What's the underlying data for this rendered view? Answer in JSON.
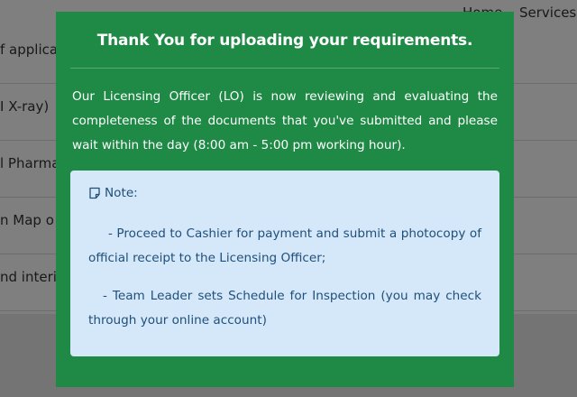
{
  "background": {
    "nav": {
      "home": "Home",
      "services": "Services"
    },
    "rows": [
      "f applica",
      "I X-ray)",
      "l Pharma",
      "n Map o",
      "nd interio"
    ]
  },
  "modal": {
    "title": "Thank You for uploading your requirements.",
    "message": "Our Licensing Officer (LO) is now reviewing and evaluating the completeness of the documents that you've submitted and please wait within the day (8:00 am - 5:00 pm working hour).",
    "note": {
      "icon": "note-icon",
      "heading": "Note:",
      "items": [
        "- Proceed to Cashier for payment and submit a photocopy of official receipt to the Licensing Officer;",
        "- Team Leader sets Schedule for Inspection (you may check through your online account)"
      ]
    }
  },
  "colors": {
    "modal_bg": "#1e8a45",
    "note_bg": "#d5e8fa",
    "note_text": "#1f4f7a"
  }
}
